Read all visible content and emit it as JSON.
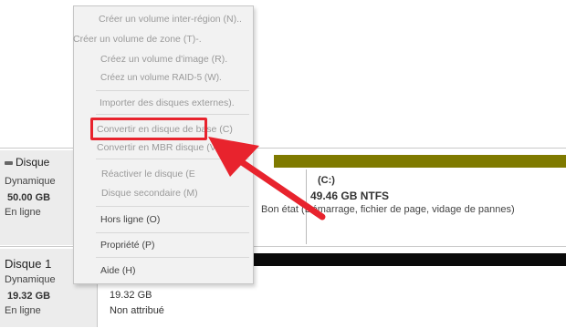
{
  "menu": {
    "items": [
      {
        "label": "Créer un volume inter-région (N)..",
        "enabled": false
      },
      {
        "label": "Créer un volume de zone (T)-.",
        "enabled": false
      },
      {
        "label": "Créez un volume d'image (R).",
        "enabled": false
      },
      {
        "label": "Créez un volume RAID-5 (W).",
        "enabled": false
      },
      {
        "label": "Importer des disques externes).",
        "enabled": false
      },
      {
        "label": "Convertir en disque de base (C)",
        "enabled": false
      },
      {
        "label": "Convertir en MBR disque (V)",
        "enabled": false
      },
      {
        "label": "Réactiver le disque (E",
        "enabled": false
      },
      {
        "label": "Disque secondaire (M)",
        "enabled": false
      },
      {
        "label": "Hors ligne (O)",
        "enabled": true
      },
      {
        "label": "Propriété (P)",
        "enabled": true
      },
      {
        "label": "Aide (H)",
        "enabled": true
      }
    ]
  },
  "disks": [
    {
      "name": "Disque",
      "type": "Dynamique",
      "size": "50.00 GB",
      "state": "En ligne"
    },
    {
      "name": "Disque 1",
      "type": "Dynamique",
      "size": "19.32 GB",
      "state": "En ligne"
    }
  ],
  "volumes": {
    "c": {
      "letter": "(C:)",
      "size": "49.46 GB NTFS",
      "status": "Bon état (Démarrage, fichier de page, vidage de pannes)",
      "bar_color": "#7f7a00"
    },
    "unallocated": {
      "size": "19.32 GB",
      "state": "Non attribué",
      "bar_color": "#0a0a0a"
    }
  },
  "annotation": {
    "highlight_color": "#e8232d",
    "arrow_color": "#e8232d"
  }
}
